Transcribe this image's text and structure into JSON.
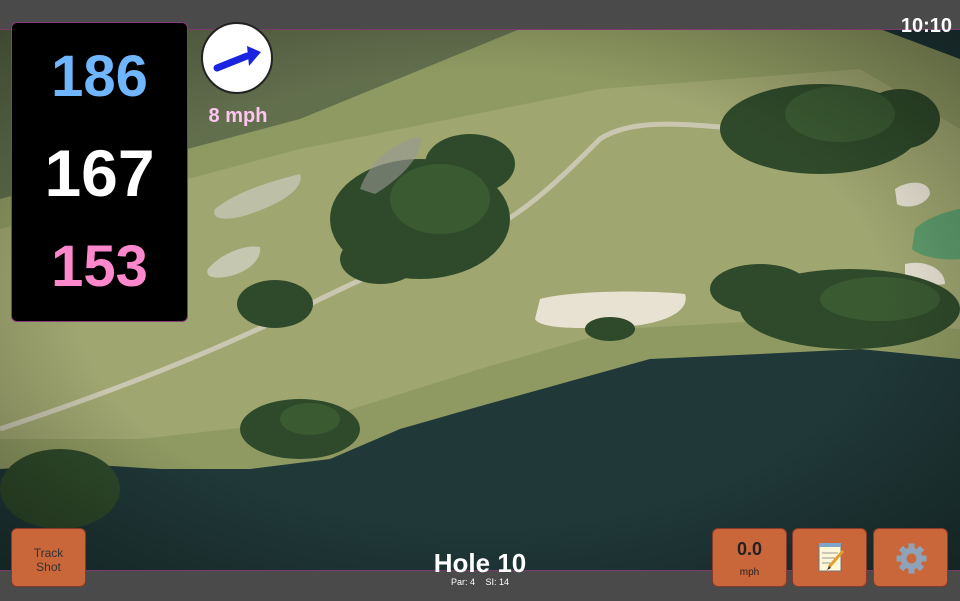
{
  "status": {
    "time": "10:10"
  },
  "yardage": {
    "back": "186",
    "middle": "167",
    "front": "153"
  },
  "wind": {
    "speed": "8 mph",
    "icon": "wind-arrow-icon"
  },
  "hole": {
    "title": "Hole 10",
    "par": "Par: 4",
    "si": "SI: 14"
  },
  "buttons": {
    "track_shot_line1": "Track",
    "track_shot_line2": "Shot",
    "speed_value": "0.0",
    "speed_unit": "mph",
    "notes_icon": "notepad-icon",
    "settings_icon": "gear-icon"
  },
  "colors": {
    "back_yardage": "#6fb6ff",
    "middle_yardage": "#ffffff",
    "front_yardage": "#ff88cc",
    "button": "#c9663a",
    "accent_border": "#7a3a6e"
  }
}
